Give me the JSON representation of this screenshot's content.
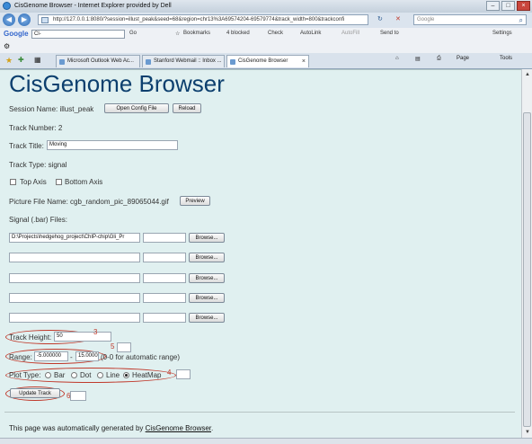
{
  "window": {
    "title": "CisGenome Browser - Internet Explorer provided by Dell"
  },
  "address_bar": {
    "url": "http://127.0.0.1:8080/?session=illust_peak&seed=68&region=chr13%3A69574204-69579774&track_width=800&trackconfi",
    "search_placeholder": "Google",
    "refresh_label": "↻",
    "stop_label": "✕"
  },
  "google_toolbar": {
    "logo": "Google",
    "search_value": "Cl-",
    "go_label": "Go",
    "bookmarks_label": "Bookmarks",
    "blocked_label": "4 blocked",
    "check_label": "Check",
    "autolink_label": "AutoLink",
    "autofill_label": "AutoFill",
    "sendto_label": "Send to",
    "settings_label": "Settings"
  },
  "tabs": [
    {
      "label": "Microsoft Outlook Web Ac..."
    },
    {
      "label": "Stanford Webmail :: Inbox ..."
    },
    {
      "label": "CisGenome Browser"
    }
  ],
  "command_bar": {
    "page_label": "Page",
    "tools_label": "Tools"
  },
  "page": {
    "heading": "CisGenome Browser",
    "session_label": "Session Name: illust_peak",
    "open_config_button": "Open Config File",
    "reload_button": "Reload",
    "track_number_label": "Track Number: 2",
    "track_title_label": "Track Title:",
    "track_title_value": "Moving",
    "track_type_label": "Track Type: signal",
    "top_axis_label": "Top Axis",
    "bottom_axis_label": "Bottom Axis",
    "picture_file_label": "Picture File Name: cgb_random_pic_89065044.gif",
    "preview_button": "Preview",
    "signal_files_label": "Signal (.bar) Files:",
    "signal_files": [
      {
        "path": "D:\\Projects\\hedgehog_project\\ChIP-chip\\Gli_Pr",
        "extra": "",
        "browse": "Browse..."
      },
      {
        "path": "",
        "extra": "",
        "browse": "Browse..."
      },
      {
        "path": "",
        "extra": "",
        "browse": "Browse..."
      },
      {
        "path": "",
        "extra": "",
        "browse": "Browse..."
      },
      {
        "path": "",
        "extra": "",
        "browse": "Browse..."
      }
    ],
    "track_height_label": "Track Height:",
    "track_height_value": "50",
    "range_label": "Range:",
    "range_min": "-5.000000",
    "range_sep": "-",
    "range_max": "15.00000",
    "range_hint": "(0-0 for automatic range)",
    "plot_type_label": "Plot Type:",
    "plot_types": [
      "Bar",
      "Dot",
      "Line",
      "HeatMap"
    ],
    "plot_type_selected": "HeatMap",
    "update_button": "Update Track",
    "footer_text": "This page was automatically generated by",
    "footer_link": "CisGenome Browser",
    "footer_period": "."
  },
  "annotations": {
    "track_height": "3",
    "range": "5",
    "plot_type": "4",
    "update": "6"
  }
}
